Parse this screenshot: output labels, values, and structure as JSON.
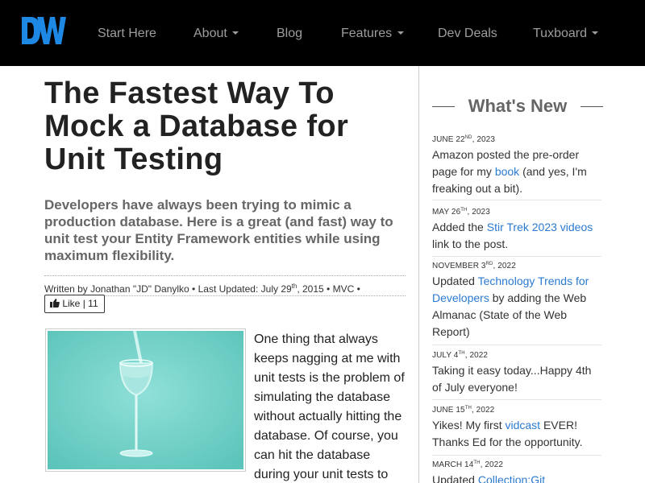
{
  "nav": {
    "logo_text": "DW",
    "items": [
      {
        "label": "Start Here",
        "dropdown": false
      },
      {
        "label": "About",
        "dropdown": true
      },
      {
        "label": "Blog",
        "dropdown": false
      },
      {
        "label": "Features",
        "dropdown": true
      },
      {
        "label": "Dev Deals",
        "dropdown": false
      },
      {
        "label": "Tuxboard",
        "dropdown": true
      }
    ]
  },
  "article": {
    "title": "The Fastest Way To Mock a Database for Unit Testing",
    "subtitle": "Developers have always been trying to mimic a production database. Here is a great (and fast) way to unit test your Entity Framework entities while using maximum flexibility.",
    "byline": {
      "written_by": "Written by Jonathan \"JD\" Danylko",
      "updated_prefix": "Last Updated: July 29",
      "updated_sup": "th",
      "updated_suffix": ", 2015",
      "category": "MVC"
    },
    "like": {
      "label": "Like",
      "count": "11"
    },
    "body": "One thing that always keeps nagging at me with unit tests is the problem of simulating the database without actually hitting the database. Of course, you can hit the database during your unit tests to"
  },
  "sidebar": {
    "title": "What's New",
    "news": [
      {
        "date": "June 22",
        "sup": "ND",
        "year": ", 2023",
        "before": "Amazon posted the pre-order page for my ",
        "link": "book",
        "after": " (and yes, I'm freaking out a bit)."
      },
      {
        "date": "May 26",
        "sup": "TH",
        "year": ", 2023",
        "before": "Added the ",
        "link": "Stir Trek 2023 videos",
        "after": " link to the post."
      },
      {
        "date": "November 3",
        "sup": "RD",
        "year": ", 2022",
        "before": "Updated ",
        "link": "Technology Trends for Developers",
        "after": " by adding the Web Almanac (State of the Web Report)"
      },
      {
        "date": "July 4",
        "sup": "TH",
        "year": ", 2022",
        "before": "Taking it easy today...Happy 4th of July everyone!",
        "link": "",
        "after": ""
      },
      {
        "date": "June 15",
        "sup": "TH",
        "year": ", 2022",
        "before": "Yikes! My first ",
        "link": "vidcast",
        "after": " EVER! Thanks Ed for the opportunity."
      },
      {
        "date": "March 14",
        "sup": "TH",
        "year": ", 2022",
        "before": "Updated ",
        "link": "Collection:Git Resources",
        "after": ""
      }
    ]
  },
  "colors": {
    "navbar": "#000000",
    "nav_text": "#9d9d9d",
    "logo_blue": "#1e88e5",
    "link": "#2b7ad1",
    "image_bg": "#6fd1c8"
  }
}
